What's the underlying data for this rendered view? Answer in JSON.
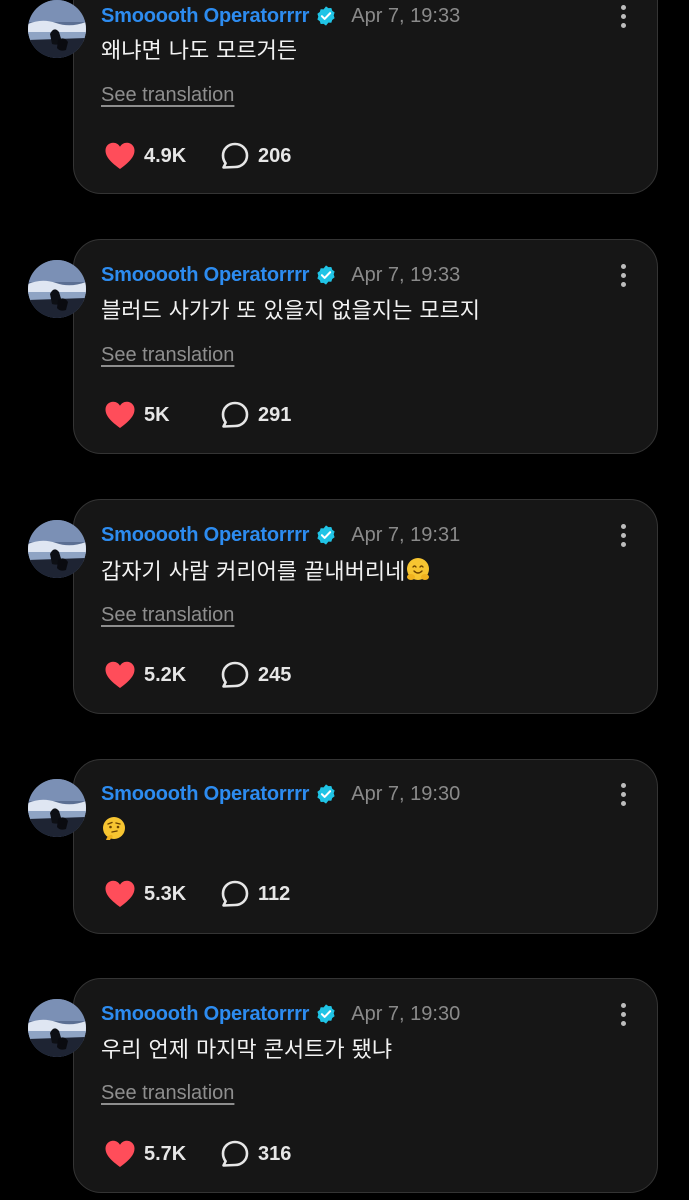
{
  "posts": [
    {
      "username": "Smooooth Operatorrrr",
      "timestamp": "Apr 7, 19:33",
      "text": "왜냐면 나도 모르거든",
      "emoji": "",
      "translate_label": "See translation",
      "likes": "4.9K",
      "replies": "206"
    },
    {
      "username": "Smooooth Operatorrrr",
      "timestamp": "Apr 7, 19:33",
      "text": "블러드 사가가 또 있을지 없을지는 모르지",
      "emoji": "",
      "translate_label": "See translation",
      "likes": "5K",
      "replies": "291"
    },
    {
      "username": "Smooooth Operatorrrr",
      "timestamp": "Apr 7, 19:31",
      "text": "갑자기 사람 커리어를 끝내버리네",
      "emoji": "hugging-face-emoji",
      "translate_label": "See translation",
      "likes": "5.2K",
      "replies": "245"
    },
    {
      "username": "Smooooth Operatorrrr",
      "timestamp": "Apr 7, 19:30",
      "text": "",
      "emoji": "thinking-face-emoji",
      "translate_label": "",
      "likes": "5.3K",
      "replies": "112"
    },
    {
      "username": "Smooooth Operatorrrr",
      "timestamp": "Apr 7, 19:30",
      "text": "우리 언제 마지막 콘서트가 됐냐",
      "emoji": "",
      "translate_label": "See translation",
      "likes": "5.7K",
      "replies": "316"
    }
  ],
  "colors": {
    "background": "#000000",
    "card": "#161616",
    "card_border": "#343434",
    "username": "#2d8cf0",
    "verified_badge": "#20c4e6",
    "timestamp": "#8a8a8a",
    "heart": "#ff4d5a",
    "text": "#f2f2f2"
  },
  "icons": {
    "like": "heart-icon",
    "reply": "speech-bubble-icon",
    "menu": "more-vertical-icon",
    "verified": "verified-badge-icon"
  }
}
